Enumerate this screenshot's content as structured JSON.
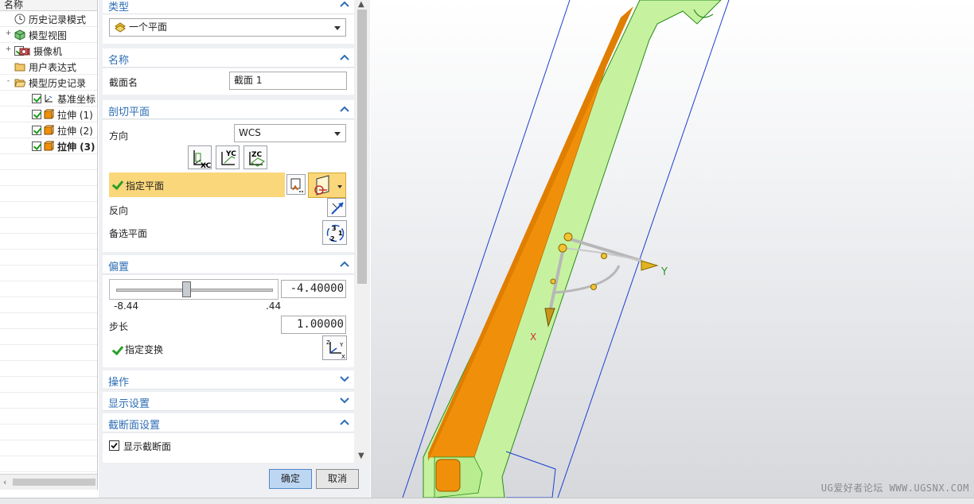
{
  "tree": {
    "header": "名称",
    "items": [
      {
        "label": "历史记录模式",
        "indent": 0,
        "expander": "",
        "checked": false,
        "icon": "clock-icon",
        "bold": false
      },
      {
        "label": "模型视图",
        "indent": 0,
        "expander": "+",
        "checked": false,
        "icon": "cube-view-icon",
        "bold": false
      },
      {
        "label": "摄像机",
        "indent": 0,
        "expander": "+",
        "checked": true,
        "icon": "camera-icon",
        "bold": false
      },
      {
        "label": "用户表达式",
        "indent": 0,
        "expander": "",
        "checked": false,
        "icon": "folder-icon",
        "bold": false
      },
      {
        "label": "模型历史记录",
        "indent": 0,
        "expander": "-",
        "checked": false,
        "icon": "folder-open-icon",
        "bold": false
      },
      {
        "label": "基准坐标",
        "indent": 1,
        "expander": "",
        "checked": true,
        "icon": "datum-csys-icon",
        "bold": false
      },
      {
        "label": "拉伸 (1)",
        "indent": 1,
        "expander": "",
        "checked": true,
        "icon": "extrude-icon",
        "bold": false
      },
      {
        "label": "拉伸 (2)",
        "indent": 1,
        "expander": "",
        "checked": true,
        "icon": "extrude-icon",
        "bold": false
      },
      {
        "label": "拉伸 (3)",
        "indent": 1,
        "expander": "",
        "checked": true,
        "icon": "extrude-icon",
        "bold": true
      }
    ]
  },
  "dialog": {
    "type_section": {
      "title": "类型",
      "value": "一个平面"
    },
    "name_section": {
      "title": "名称",
      "label": "截面名",
      "value": "截面 1"
    },
    "plane_section": {
      "title": "剖切平面",
      "direction_label": "方向",
      "direction_value": "WCS",
      "axis_buttons": [
        "XC",
        "YC",
        "ZC"
      ],
      "specify_plane": "指定平面",
      "reverse": "反向",
      "alt_plane": "备选平面"
    },
    "offset_section": {
      "title": "偏置",
      "value": "-4.40000",
      "slider_min": "-8.44",
      "slider_max": ".44",
      "slider_fraction": 0.45,
      "step_label": "步长",
      "step_value": "1.00000",
      "specify_transform": "指定变换"
    },
    "operation_section": {
      "title": "操作"
    },
    "display_section": {
      "title": "显示设置"
    },
    "cut_section": {
      "title": "截断面设置",
      "show_cut": "显示截断面"
    },
    "ok": "确定",
    "cancel": "取消"
  },
  "viewport": {
    "watermark": "UG爱好者论坛 WWW.UGSNX.COM",
    "axis_y": "Y",
    "axis_x": "X",
    "colors": {
      "orange_face": "#f0900a",
      "green_body": "#c6f2a0",
      "edge": "#2a8a1a",
      "boundary": "#1a3fd0"
    }
  }
}
